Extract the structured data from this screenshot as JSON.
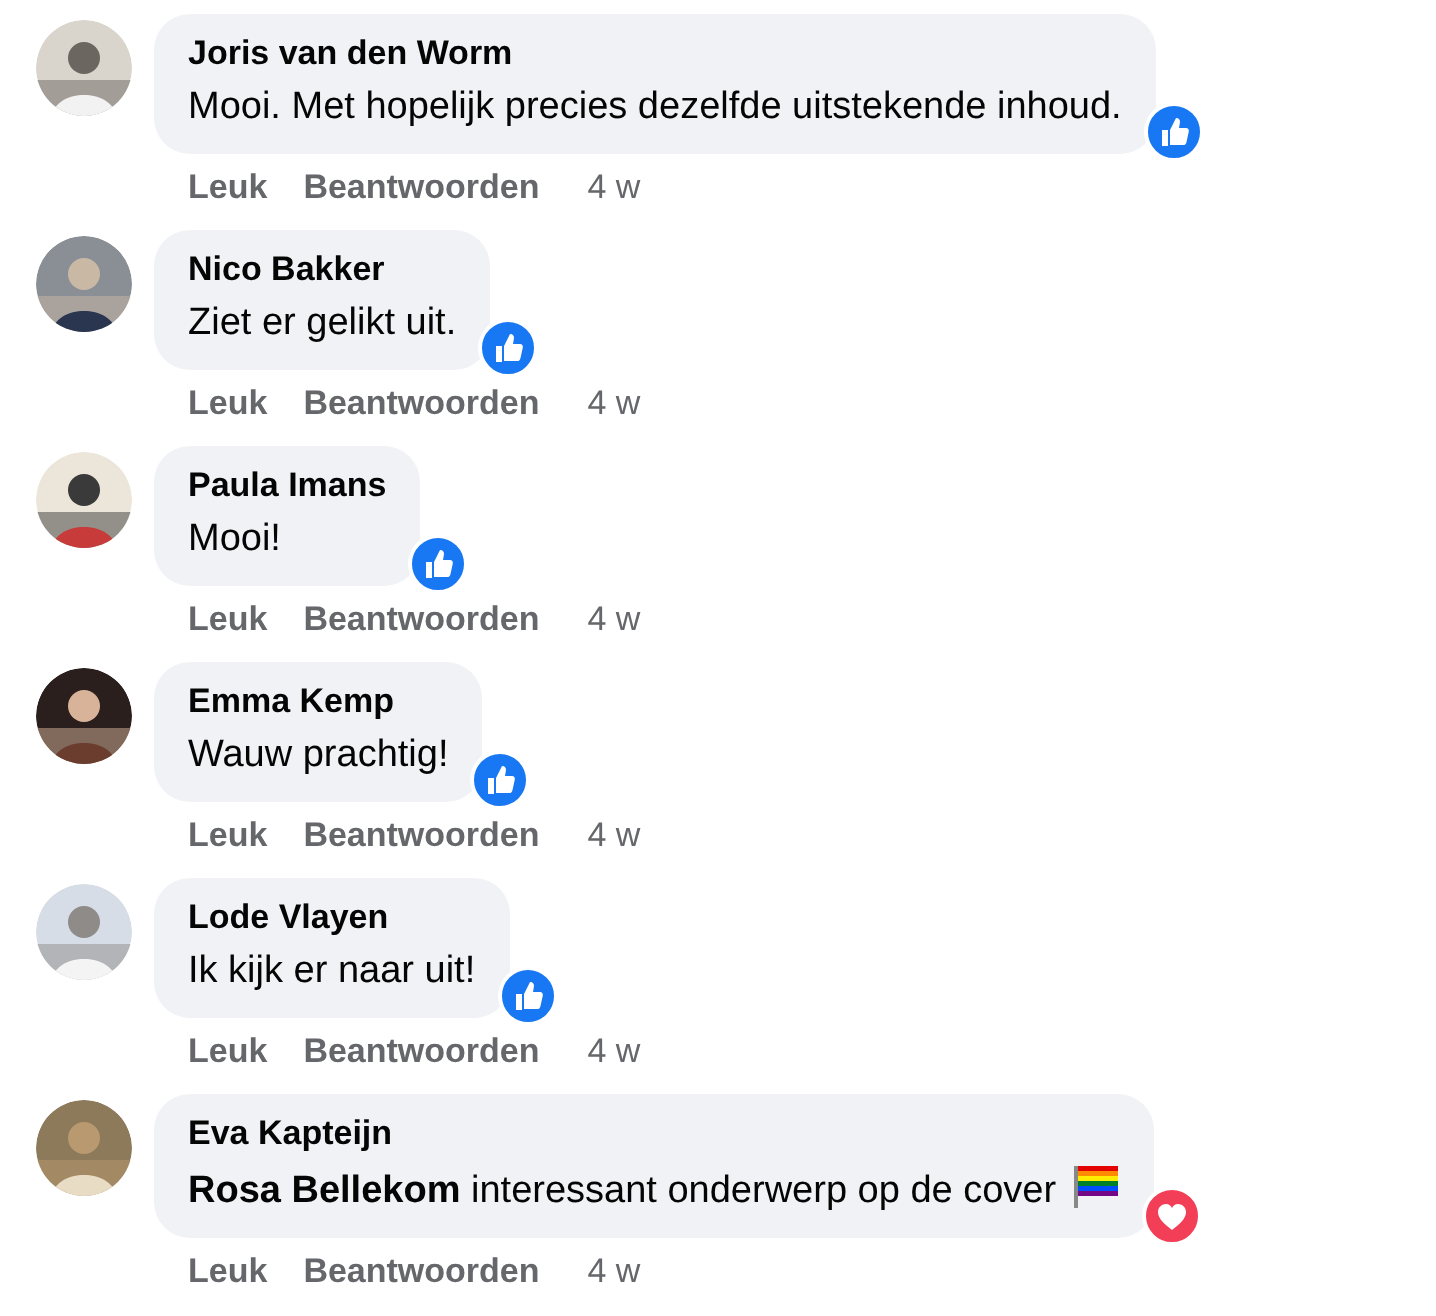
{
  "comments": [
    {
      "author": "Joris van den Worm",
      "text": "Mooi. Met hopelijk precies dezelfde uitstekende inhoud.",
      "reaction": {
        "kind": "like"
      },
      "flag": false,
      "actions": [
        "Leuk",
        "Beantwoorden"
      ],
      "time": "4 w"
    },
    {
      "author": "Nico Bakker",
      "text": "Ziet er gelikt uit.",
      "reaction": {
        "kind": "like"
      },
      "flag": false,
      "actions": [
        "Leuk",
        "Beantwoorden"
      ],
      "time": "4 w"
    },
    {
      "author": "Paula Imans",
      "text": "Mooi!",
      "reaction": {
        "kind": "like"
      },
      "flag": false,
      "actions": [
        "Leuk",
        "Beantwoorden"
      ],
      "time": "4 w"
    },
    {
      "author": "Emma Kemp",
      "text": "Wauw prachtig!",
      "reaction": {
        "kind": "like"
      },
      "flag": false,
      "actions": [
        "Leuk",
        "Beantwoorden"
      ],
      "time": "4 w"
    },
    {
      "author": "Lode Vlayen",
      "text": "Ik kijk er naar uit!",
      "reaction": {
        "kind": "like"
      },
      "flag": false,
      "actions": [
        "Leuk",
        "Beantwoorden"
      ],
      "time": "4 w"
    },
    {
      "author": "Eva Kapteijn",
      "text": "**Rosa Bellekom** interessant onderwerp op de cover",
      "reaction": {
        "kind": "love"
      },
      "flag": true,
      "actions": [
        "Leuk",
        "Beantwoorden"
      ],
      "time": "4 w"
    }
  ]
}
